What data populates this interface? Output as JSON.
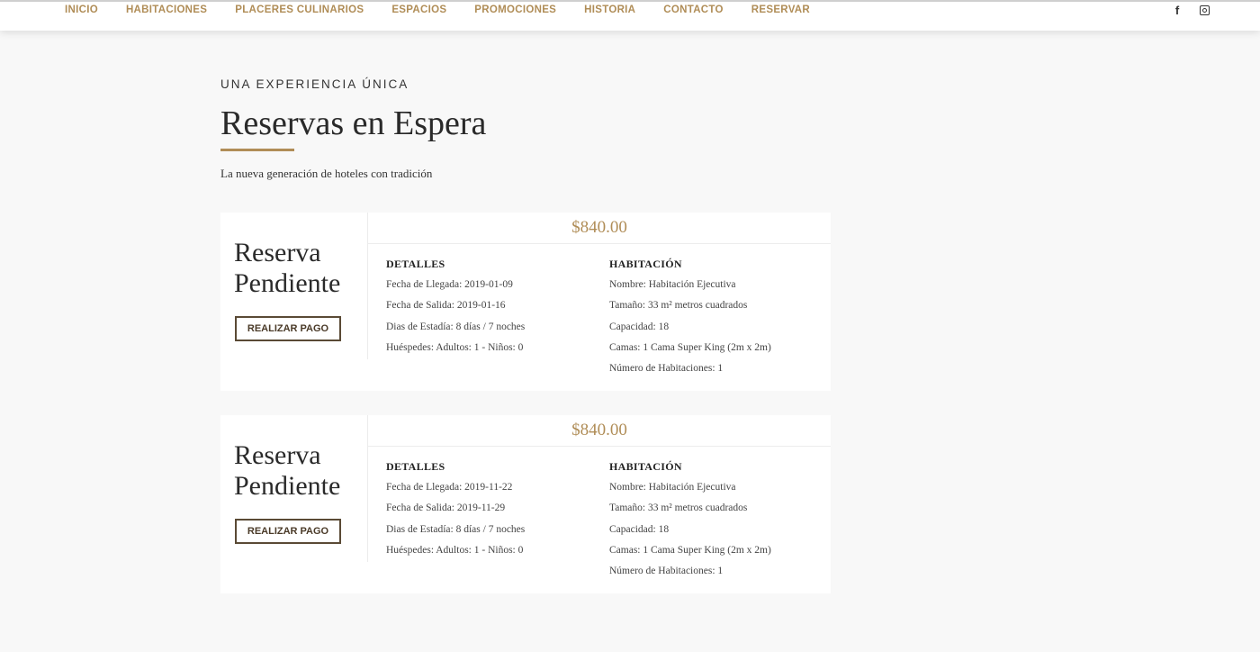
{
  "nav": {
    "items": [
      "INICIO",
      "HABITACIONES",
      "PLACERES CULINARIOS",
      "ESPACIOS",
      "PROMOCIONES",
      "HISTORIA",
      "CONTACTO",
      "RESERVAR"
    ]
  },
  "social": {
    "facebook_glyph": "f",
    "icons": [
      "facebook-icon",
      "instagram-icon"
    ]
  },
  "header": {
    "eyebrow": "UNA EXPERIENCIA ÚNICA",
    "title": "Reservas en Espera",
    "subtitle": "La nueva generación de hoteles con tradición"
  },
  "colors": {
    "accent": "#b08d57",
    "background": "#f8f8f8",
    "card": "#ffffff"
  },
  "reservations": [
    {
      "status": "Reserva Pendiente",
      "pay_label": "REALIZAR PAGO",
      "price": "$840.00",
      "details_title": "DETALLES",
      "details": [
        "Fecha de Llegada: 2019-01-09",
        "Fecha de Salida: 2019-01-16",
        "Dias de Estadía: 8 días / 7 noches",
        "Huéspedes: Adultos: 1 - Niños: 0"
      ],
      "room_title": "HABITACIÓN",
      "room": [
        "Nombre: Habitación Ejecutiva",
        "Tamaño: 33 m² metros cuadrados",
        "Capacidad: 18",
        "Camas: 1 Cama Super King (2m x 2m)",
        "Número de Habitaciones: 1"
      ]
    },
    {
      "status": "Reserva Pendiente",
      "pay_label": "REALIZAR PAGO",
      "price": "$840.00",
      "details_title": "DETALLES",
      "details": [
        "Fecha de Llegada: 2019-11-22",
        "Fecha de Salida: 2019-11-29",
        "Dias de Estadía: 8 días / 7 noches",
        "Huéspedes: Adultos: 1 - Niños: 0"
      ],
      "room_title": "HABITACIÓN",
      "room": [
        "Nombre: Habitación Ejecutiva",
        "Tamaño: 33 m² metros cuadrados",
        "Capacidad: 18",
        "Camas: 1 Cama Super King (2m x 2m)",
        "Número de Habitaciones: 1"
      ]
    }
  ]
}
